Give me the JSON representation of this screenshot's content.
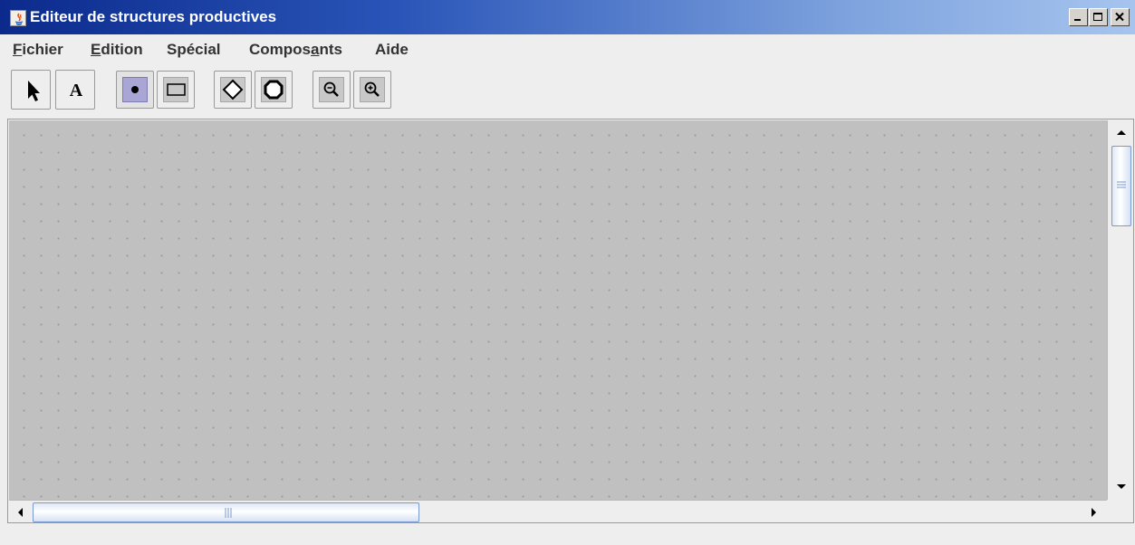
{
  "window": {
    "title": "Editeur de structures productives",
    "controls": [
      "minimize",
      "maximize",
      "close"
    ]
  },
  "menubar": {
    "items": [
      {
        "label": "Fichier",
        "mnemonic": "F"
      },
      {
        "label": "Edition",
        "mnemonic": "E"
      },
      {
        "label": "Spécial"
      },
      {
        "label": "Composants",
        "mnemonic": "a"
      },
      {
        "label": "Aide"
      }
    ]
  },
  "toolbar": {
    "tools": [
      {
        "name": "select-tool",
        "icon": "arrow-pointer-icon"
      },
      {
        "name": "text-tool",
        "icon": "text-A-icon",
        "letter": "A"
      },
      {
        "name": "node-tool",
        "icon": "dot-node-icon",
        "selected": true
      },
      {
        "name": "rectangle-tool",
        "icon": "rectangle-icon"
      },
      {
        "name": "diamond-tool",
        "icon": "diamond-icon"
      },
      {
        "name": "octagon-tool",
        "icon": "octagon-icon"
      },
      {
        "name": "zoom-out-tool",
        "icon": "zoom-out-icon"
      },
      {
        "name": "zoom-in-tool",
        "icon": "zoom-in-icon"
      }
    ]
  },
  "canvas": {
    "background_color": "#c0c0c0",
    "grid": true,
    "grid_dot_color": "#9c9c9c"
  },
  "colors": {
    "titlebar_start": "#0b2a8c",
    "titlebar_end": "#a6c4ee",
    "selected_tool_bg": "#a9a6d6",
    "scroll_thumb_border": "#7a99cf"
  }
}
